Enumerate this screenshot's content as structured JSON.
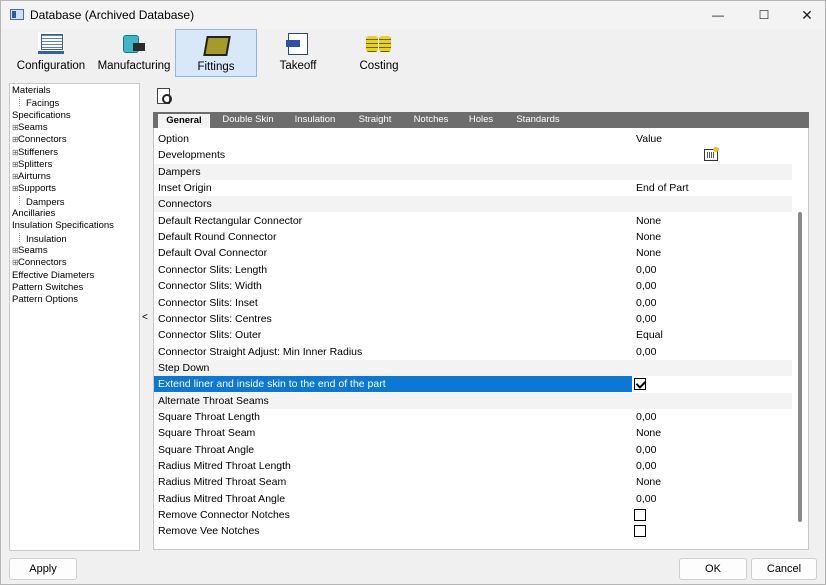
{
  "window": {
    "title": "Database (Archived Database)",
    "minimize": "—",
    "maximize": "☐",
    "close": "✕"
  },
  "toolbar": {
    "items": [
      {
        "label": "Configuration",
        "icon": "book-icon"
      },
      {
        "label": "Manufacturing",
        "icon": "manufacturing-icon"
      },
      {
        "label": "Fittings",
        "icon": "fittings-icon",
        "active": true
      },
      {
        "label": "Takeoff",
        "icon": "takeoff-icon"
      },
      {
        "label": "Costing",
        "icon": "coins-icon"
      }
    ]
  },
  "tree": {
    "items": [
      {
        "label": "Materials",
        "level": 0
      },
      {
        "label": "Facings",
        "level": 1
      },
      {
        "label": "Specifications",
        "level": 0
      },
      {
        "label": "Seams",
        "level": 0,
        "expandable": true
      },
      {
        "label": "Connectors",
        "level": 0,
        "expandable": true
      },
      {
        "label": "Stiffeners",
        "level": 0,
        "expandable": true
      },
      {
        "label": "Splitters",
        "level": 0,
        "expandable": true
      },
      {
        "label": "Airturns",
        "level": 0,
        "expandable": true
      },
      {
        "label": "Supports",
        "level": 0,
        "expandable": true
      },
      {
        "label": "Dampers",
        "level": 1
      },
      {
        "label": "Ancillaries",
        "level": 0
      },
      {
        "label": "Insulation Specifications",
        "level": 0
      },
      {
        "label": "Insulation",
        "level": 1
      },
      {
        "label": "Seams",
        "level": 0,
        "expandable": true
      },
      {
        "label": "Connectors",
        "level": 0,
        "expandable": true
      },
      {
        "label": "Effective Diameters",
        "level": 0
      },
      {
        "label": "Pattern Switches",
        "level": 0
      },
      {
        "label": "Pattern Options",
        "level": 0
      }
    ],
    "expand_glyph": "⊞",
    "splitter": "<"
  },
  "tabs": [
    "General",
    "Double Skin",
    "Insulation",
    "Straight",
    "Notches",
    "Holes",
    "Standards"
  ],
  "active_tab": "General",
  "grid": {
    "header": {
      "option": "Option",
      "value": "Value"
    },
    "rows": [
      {
        "option": "Developments",
        "value": "",
        "kind": "icon"
      },
      {
        "option": "Dampers",
        "value": "",
        "kind": "section"
      },
      {
        "option": "Inset Origin",
        "value": "End of Part"
      },
      {
        "option": "Connectors",
        "value": "",
        "kind": "section"
      },
      {
        "option": "Default Rectangular Connector",
        "value": "None"
      },
      {
        "option": "Default Round Connector",
        "value": "None"
      },
      {
        "option": "Default Oval Connector",
        "value": "None"
      },
      {
        "option": "Connector Slits: Length",
        "value": "0,00"
      },
      {
        "option": "Connector Slits: Width",
        "value": "0,00"
      },
      {
        "option": "Connector Slits: Inset",
        "value": "0,00"
      },
      {
        "option": "Connector Slits: Centres",
        "value": "0,00"
      },
      {
        "option": "Connector Slits: Outer",
        "value": "Equal"
      },
      {
        "option": "Connector Straight Adjust: Min Inner Radius",
        "value": "0,00"
      },
      {
        "option": "Step Down",
        "value": "",
        "kind": "section"
      },
      {
        "option": "Extend liner and inside skin to the end of the part",
        "value": "",
        "kind": "checkbox",
        "checked": true,
        "selected": true
      },
      {
        "option": "Alternate Throat Seams",
        "value": "",
        "kind": "section"
      },
      {
        "option": "Square Throat Length",
        "value": "0,00"
      },
      {
        "option": "Square Throat Seam",
        "value": "None"
      },
      {
        "option": "Square Throat Angle",
        "value": "0,00"
      },
      {
        "option": "Radius Mitred Throat Length",
        "value": "0,00"
      },
      {
        "option": "Radius Mitred Throat Seam",
        "value": "None"
      },
      {
        "option": "Radius Mitred Throat Angle",
        "value": "0,00"
      },
      {
        "option": "Remove Connector Notches",
        "value": "",
        "kind": "checkbox",
        "checked": false
      },
      {
        "option": "Remove Vee Notches",
        "value": "",
        "kind": "checkbox",
        "checked": false
      }
    ]
  },
  "buttons": {
    "apply": "Apply",
    "ok": "OK",
    "cancel": "Cancel"
  },
  "colors": {
    "selection": "#0a78d4",
    "tabstrip": "#6d6d6d",
    "active_tool": "#d9e8f9"
  }
}
